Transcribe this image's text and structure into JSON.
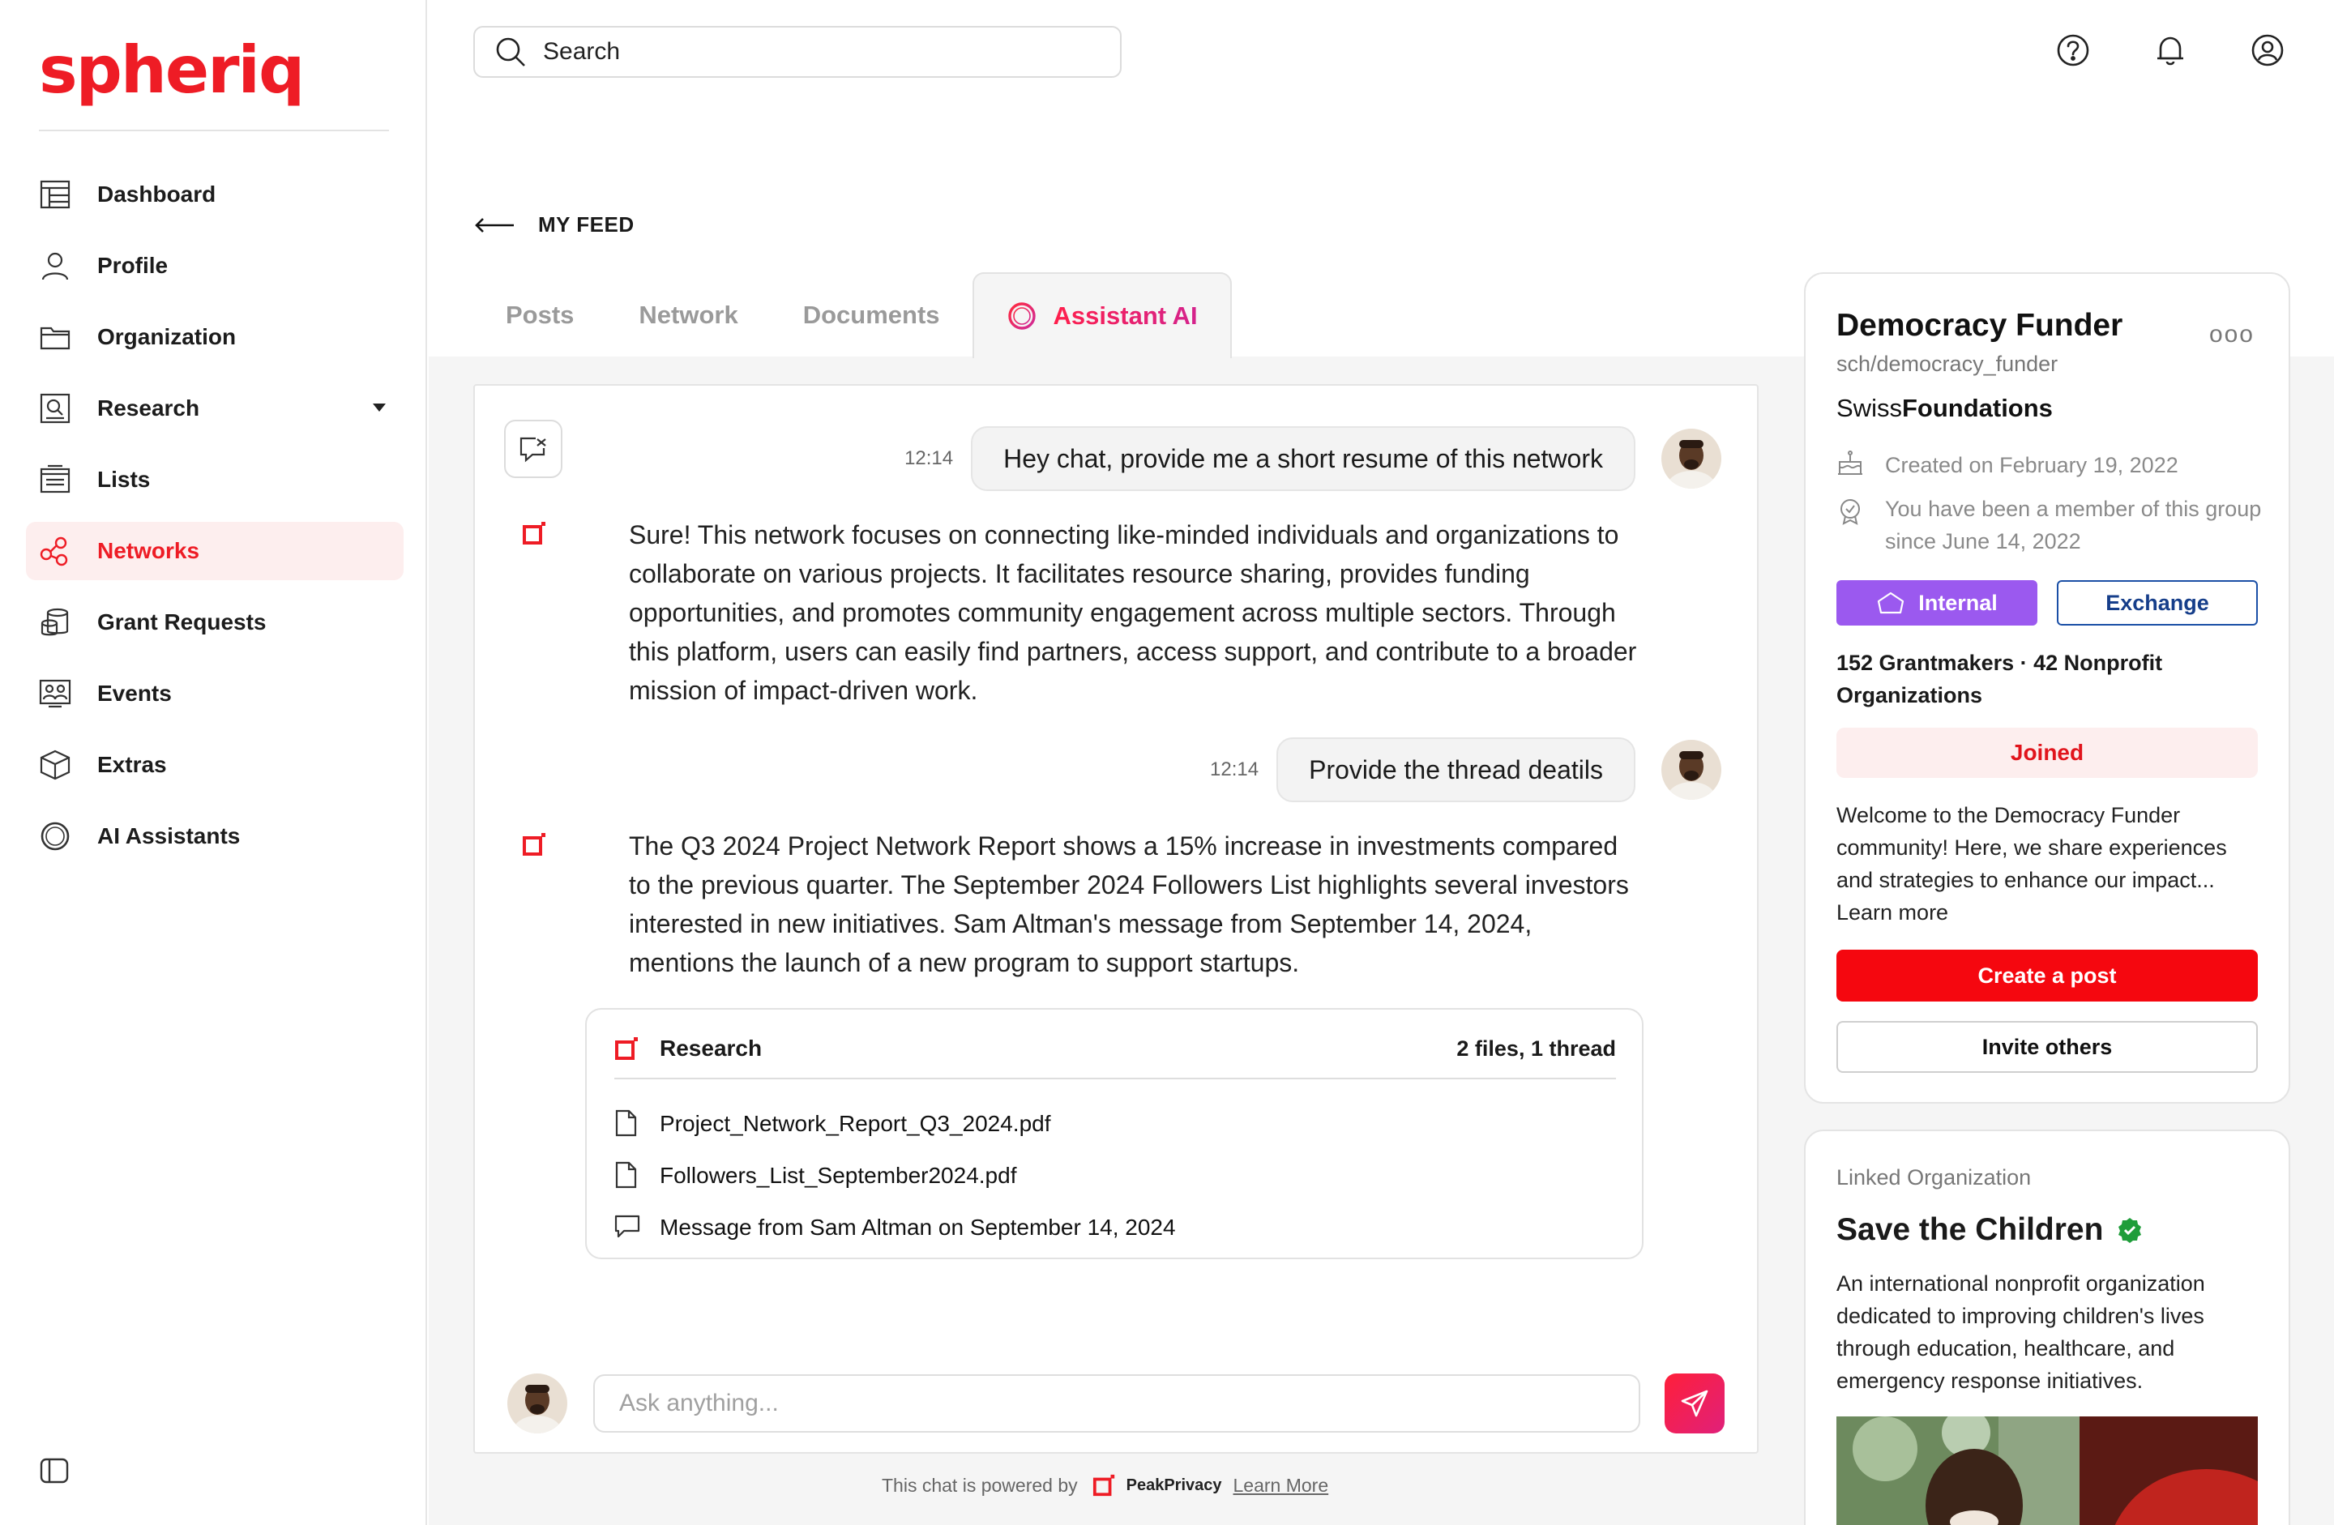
{
  "brand": {
    "logo_text": "spheriq",
    "accent": "#ee1c25"
  },
  "sidebar": {
    "items": [
      {
        "label": "Dashboard",
        "icon": "dashboard-icon"
      },
      {
        "label": "Profile",
        "icon": "user-icon"
      },
      {
        "label": "Organization",
        "icon": "folder-icon"
      },
      {
        "label": "Research",
        "icon": "research-icon",
        "has_dropdown": true
      },
      {
        "label": "Lists",
        "icon": "list-icon"
      },
      {
        "label": "Networks",
        "icon": "network-icon",
        "active": true
      },
      {
        "label": "Grant Requests",
        "icon": "coins-icon"
      },
      {
        "label": "Events",
        "icon": "events-icon"
      },
      {
        "label": "Extras",
        "icon": "box-icon"
      },
      {
        "label": "AI Assistants",
        "icon": "ai-ring-icon"
      }
    ]
  },
  "header": {
    "search_label": "Search",
    "icons": [
      "help-icon",
      "bell-icon",
      "account-icon"
    ]
  },
  "breadcrumb": {
    "label": "MY FEED"
  },
  "tabs": [
    {
      "label": "Posts"
    },
    {
      "label": "Network"
    },
    {
      "label": "Documents"
    },
    {
      "label": "Assistant AI",
      "active": true
    }
  ],
  "chat": {
    "messages": [
      {
        "role": "user",
        "time": "12:14",
        "text": "Hey chat, provide me a short resume of this network"
      },
      {
        "role": "assistant",
        "text": "Sure! This network focuses on connecting like-minded individuals and organizations to collaborate on various projects. It facilitates resource sharing, provides funding opportunities, and promotes community engagement across multiple sectors. Through this platform, users can easily find partners, access support, and contribute to a broader mission of impact-driven work."
      },
      {
        "role": "user",
        "time": "12:14",
        "text": "Provide the thread deatils"
      },
      {
        "role": "assistant",
        "text": "The Q3 2024 Project Network Report shows a 15% increase in investments compared to the previous quarter. The September 2024 Followers List highlights several investors interested in new initiatives. Sam Altman's message from September 14, 2024, mentions the launch of a new program to support startups."
      }
    ],
    "research": {
      "title": "Research",
      "meta": "2 files, 1 thread",
      "items": [
        {
          "type": "file",
          "name": "Project_Network_Report_Q3_2024.pdf"
        },
        {
          "type": "file",
          "name": "Followers_List_September2024.pdf"
        },
        {
          "type": "thread",
          "name": "Message from Sam Altman on September 14, 2024"
        }
      ]
    },
    "input_placeholder": "Ask anything...",
    "powered_by": {
      "prefix": "This chat is powered by",
      "brand": "PeakPrivacy",
      "link": "Learn More"
    }
  },
  "network_card": {
    "title": "Democracy Funder",
    "more": "ooo",
    "handle": "sch/democracy_funder",
    "org_prefix": "Swiss",
    "org_bold": "Foundations",
    "created": "Created on February 19, 2022",
    "member_since": "You have been a member of this group since June 14, 2022",
    "badge_internal": "Internal",
    "badge_exchange": "Exchange",
    "stats": "152 Grantmakers · 42 Nonprofit Organizations",
    "joined": "Joined",
    "description": "Welcome to the Democracy Funder community! Here, we share experiences and strategies to enhance our impact... Learn more",
    "create_post": "Create a post",
    "invite": "Invite others",
    "colors": {
      "internal": "#9b59ef",
      "exchange": "#1a4fa6",
      "create": "#f5070f"
    }
  },
  "linked_org": {
    "label": "Linked Organization",
    "title": "Save the Children",
    "verified": true,
    "description": "An international nonprofit organization dedicated to improving children's lives through education, healthcare, and emergency response initiatives."
  }
}
